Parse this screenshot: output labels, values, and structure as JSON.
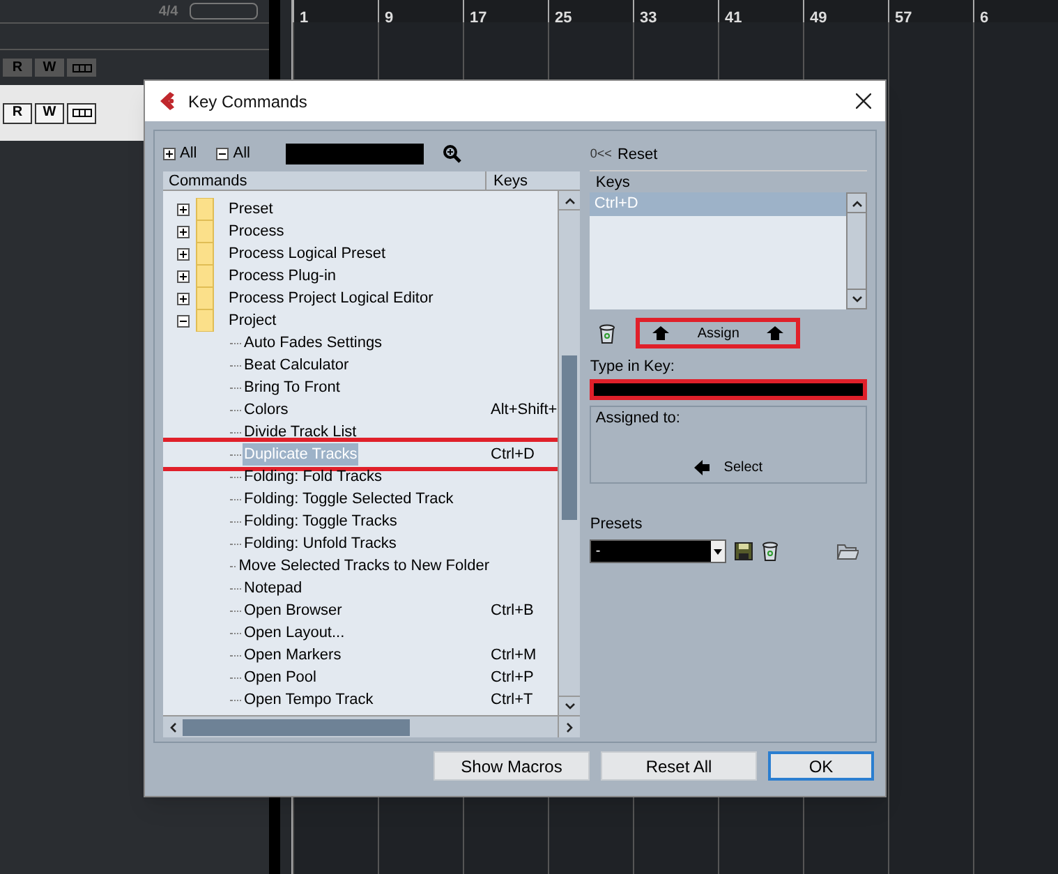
{
  "background": {
    "ruler_numbers": [
      "1",
      "9",
      "17",
      "25",
      "33",
      "41",
      "49",
      "57",
      "6"
    ],
    "time_signature": "4/4",
    "track_buttons": [
      {
        "read": "R",
        "write": "W"
      },
      {
        "read": "R",
        "write": "W"
      }
    ]
  },
  "window": {
    "title": "Key Commands"
  },
  "toolbar": {
    "expand_all": "All",
    "collapse_all": "All"
  },
  "tree": {
    "columns": [
      "Commands",
      "Keys"
    ],
    "items": [
      {
        "name": "Preset",
        "expanded": false
      },
      {
        "name": "Process",
        "expanded": false
      },
      {
        "name": "Process Logical Preset",
        "expanded": false
      },
      {
        "name": "Process Plug-in",
        "expanded": false
      },
      {
        "name": "Process Project Logical Editor",
        "expanded": false
      },
      {
        "name": "Project",
        "expanded": true,
        "children": [
          {
            "name": "Auto Fades Settings",
            "selected": false
          },
          {
            "name": "Beat Calculator",
            "selected": false
          },
          {
            "name": "Bring To Front",
            "selected": false
          },
          {
            "name": "Colors",
            "keys": "Alt+Shift+",
            "selected": false
          },
          {
            "name": "Divide Track List",
            "selected": false
          },
          {
            "name": "Duplicate Tracks",
            "keys": "Ctrl+D",
            "selected": true,
            "highlighted": true
          },
          {
            "name": "Folding: Fold Tracks",
            "selected": false
          },
          {
            "name": "Folding: Toggle Selected Track",
            "selected": false
          },
          {
            "name": "Folding: Toggle Tracks",
            "selected": false
          },
          {
            "name": "Folding: Unfold Tracks",
            "selected": false
          },
          {
            "name": "Move Selected Tracks to New Folder",
            "selected": false
          },
          {
            "name": "Notepad",
            "selected": false
          },
          {
            "name": "Open Browser",
            "keys": "Ctrl+B",
            "selected": false
          },
          {
            "name": "Open Layout...",
            "selected": false
          },
          {
            "name": "Open Markers",
            "keys": "Ctrl+M",
            "selected": false
          },
          {
            "name": "Open Pool",
            "keys": "Ctrl+P",
            "selected": false
          },
          {
            "name": "Open Tempo Track",
            "keys": "Ctrl+T",
            "selected": false
          }
        ]
      }
    ]
  },
  "reset": {
    "prefix": "0<<",
    "label": "Reset"
  },
  "keys": {
    "header": "Keys",
    "items": [
      {
        "key": "Ctrl+D",
        "selected": true
      }
    ]
  },
  "assign": {
    "label": "Assign",
    "highlighted": true
  },
  "type_in_key": {
    "label": "Type in Key:",
    "highlighted": true
  },
  "assigned_to": {
    "label": "Assigned to:",
    "select": "Select"
  },
  "presets": {
    "label": "Presets",
    "value": "-"
  },
  "buttons": [
    {
      "label": "Show Macros",
      "default": false
    },
    {
      "label": "Reset All",
      "default": false
    },
    {
      "label": "OK",
      "default": true
    }
  ]
}
